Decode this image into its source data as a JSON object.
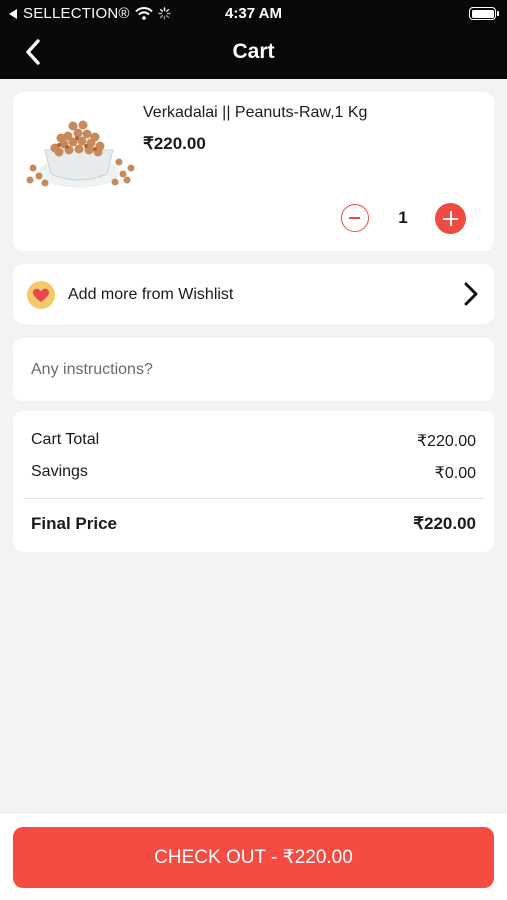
{
  "status_bar": {
    "carrier": "SELLECTION®",
    "time": "4:37 AM"
  },
  "nav": {
    "title": "Cart"
  },
  "cart_item": {
    "name": "Verkadalai || Peanuts-Raw,1 Kg",
    "price": "₹220.00",
    "quantity": "1"
  },
  "wishlist": {
    "label": "Add more from Wishlist"
  },
  "instructions": {
    "placeholder": "Any instructions?"
  },
  "summary": {
    "cart_total_label": "Cart Total",
    "cart_total_value": "₹220.00",
    "savings_label": "Savings",
    "savings_value": "₹0.00",
    "final_label": "Final Price",
    "final_value": "₹220.00"
  },
  "checkout": {
    "label": "CHECK OUT - ₹220.00"
  },
  "colors": {
    "accent": "#f54b42",
    "header_bg": "#080808",
    "page_bg": "#f3f3f3"
  },
  "icons": [
    "back-chevron-icon",
    "wifi-icon",
    "activity-spinner-icon",
    "battery-icon",
    "minus-circle-icon",
    "plus-circle-icon",
    "heart-icon",
    "chevron-right-icon"
  ]
}
